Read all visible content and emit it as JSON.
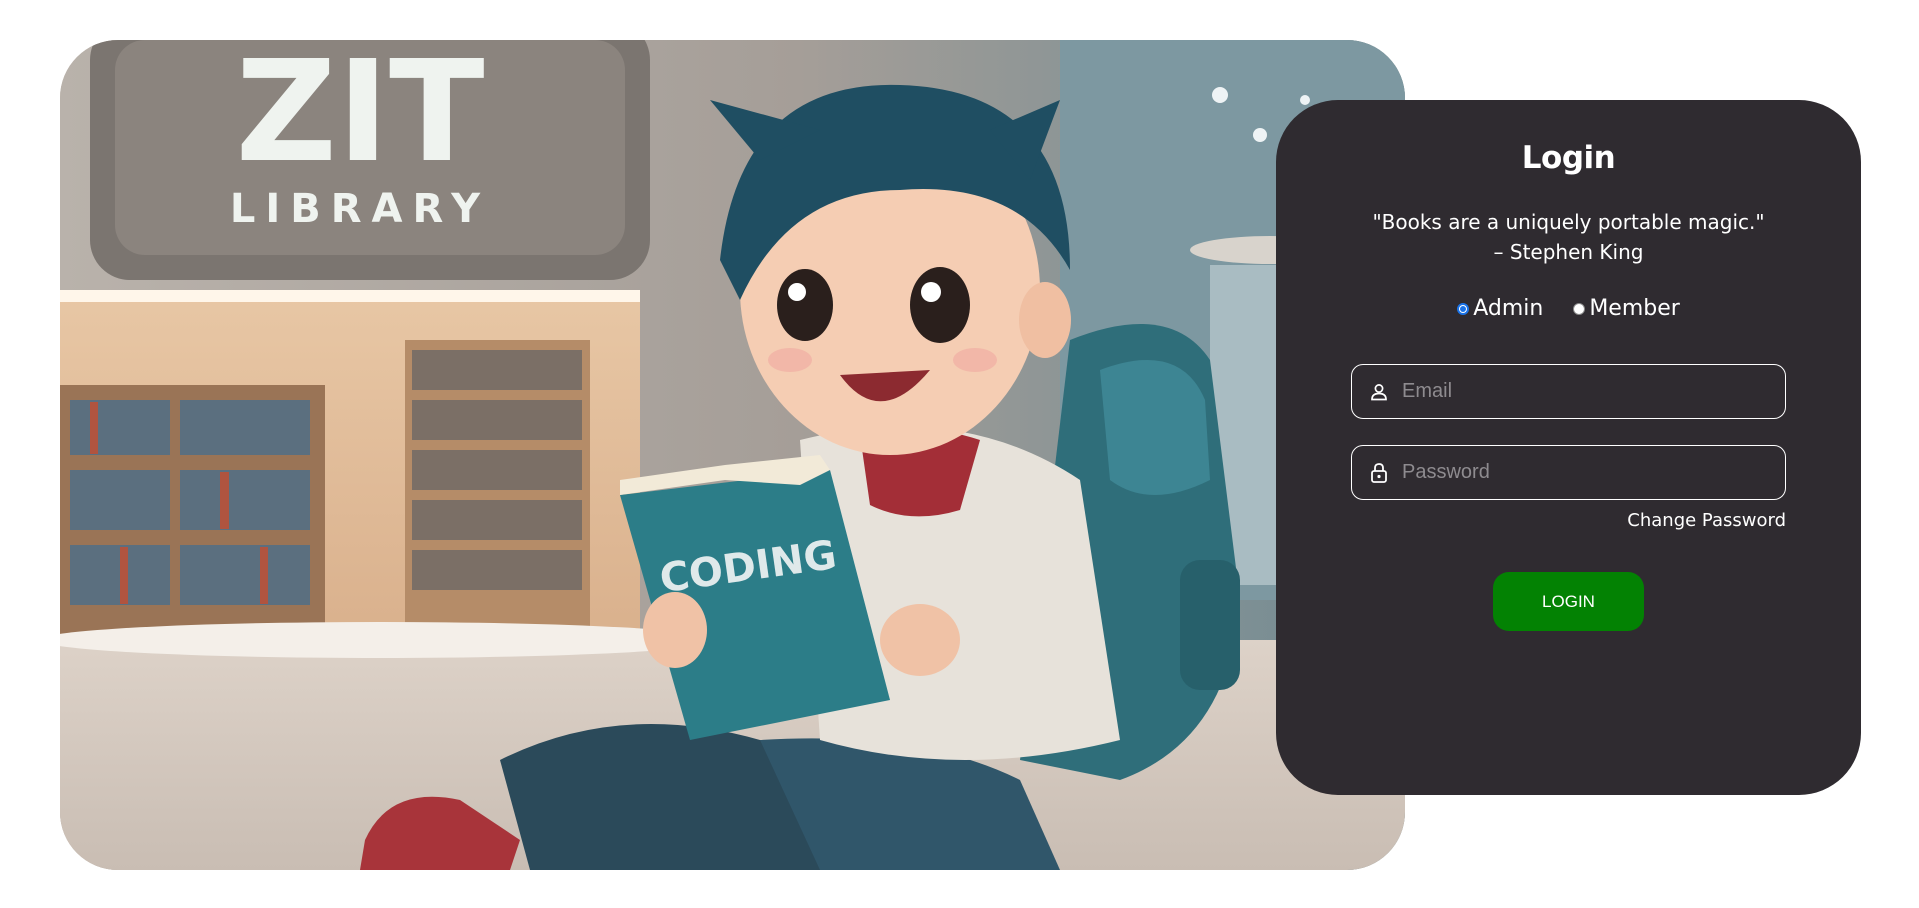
{
  "hero": {
    "sign_title": "ZIT",
    "sign_subtitle": "LIBRARY",
    "book_title": "CODING",
    "icon": "library-illustration"
  },
  "login": {
    "title": "Login",
    "quote_line1": "\"Books are a uniquely portable magic.\"",
    "quote_line2": "– Stephen King",
    "roles": [
      {
        "label": "Admin",
        "checked": true
      },
      {
        "label": "Member",
        "checked": false
      }
    ],
    "email_placeholder": "Email",
    "email_icon": "user-icon",
    "password_placeholder": "Password",
    "password_icon": "lock-icon",
    "change_password_label": "Change Password",
    "login_button_label": "LOGIN"
  },
  "colors": {
    "card_bg": "#2f2b30",
    "button_green": "#038203",
    "radio_blue": "#1a73e8"
  }
}
